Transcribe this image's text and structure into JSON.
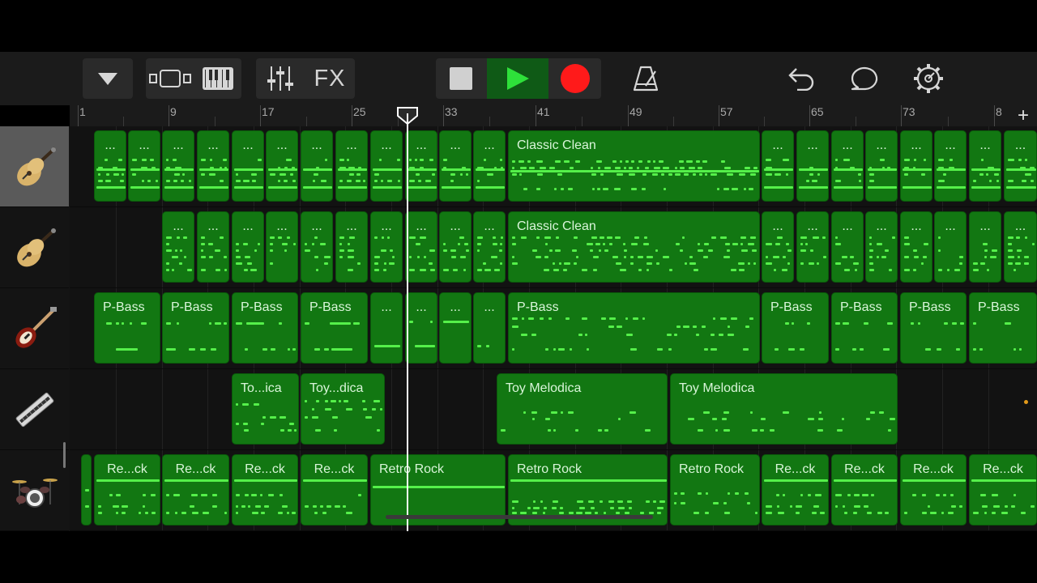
{
  "toolbar": {
    "browser_icon": "triangle-down-icon",
    "tracks_view_icon": "tracks-view-icon",
    "keyboard_icon": "piano-keyboard-icon",
    "mixer_icon": "mixer-sliders-icon",
    "fx_label": "FX",
    "stop_icon": "stop-icon",
    "play_icon": "play-icon",
    "record_icon": "record-icon",
    "metronome_icon": "metronome-icon",
    "undo_icon": "undo-icon",
    "loop_icon": "loop-browser-icon",
    "settings_icon": "settings-gear-icon",
    "colors": {
      "play_active_bg": "#0f5a16",
      "play_green": "#2ee03a",
      "record_red": "#ff1a1a"
    }
  },
  "ruler": {
    "bars": [
      "1",
      "9",
      "17",
      "25",
      "33",
      "41",
      "49",
      "57",
      "65",
      "73",
      "8"
    ],
    "add_label": "+"
  },
  "tracks": [
    {
      "instrument": "acoustic-guitar-icon",
      "selected": true
    },
    {
      "instrument": "acoustic-guitar-icon",
      "selected": false
    },
    {
      "instrument": "bass-guitar-icon",
      "selected": false
    },
    {
      "instrument": "harmonica-icon",
      "selected": false
    },
    {
      "instrument": "drum-kit-icon",
      "selected": false
    }
  ],
  "regions": {
    "track1_short": "...",
    "track1_main": "Classic Clean",
    "track2_short": "...",
    "track2_main": "Classic Clean",
    "track3_pbass": "P-Bass",
    "track3_short": "...",
    "track4_short1": "To...ica",
    "track4_short2": "Toy...dica",
    "track4_main": "Toy Melodica",
    "track5_short": "Re...ck",
    "track5_main": "Retro Rock"
  },
  "colors": {
    "region_fill": "#127712",
    "note_green": "#55f04a",
    "background": "#121212"
  }
}
